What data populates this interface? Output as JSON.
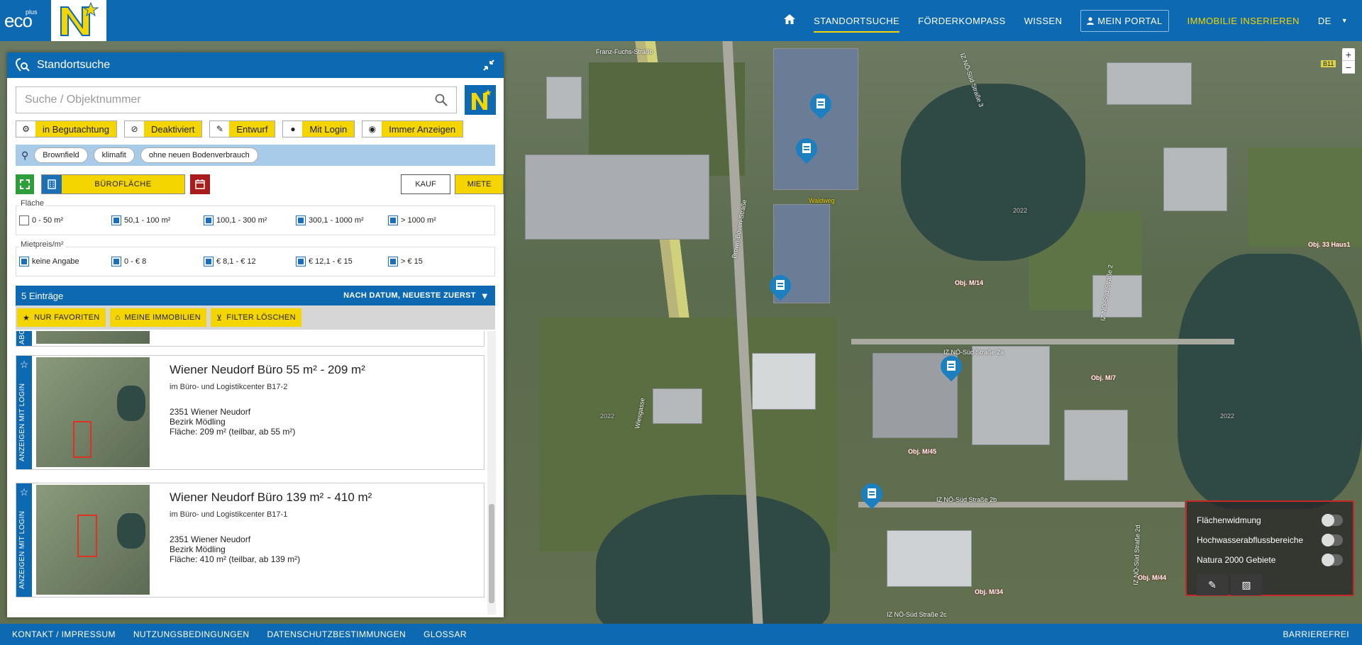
{
  "header": {
    "logo_text": "eco",
    "logo_plus": "plus",
    "nav": [
      "STANDORTSUCHE",
      "FÖRDERKOMPASS",
      "WISSEN"
    ],
    "portal": "MEIN PORTAL",
    "insert": "IMMOBILIE INSERIEREN",
    "lang": "DE",
    "accent": "#f5d500",
    "brand": "#0d69b1"
  },
  "panel": {
    "title": "Standortsuche",
    "search_placeholder": "Suche / Objektnummer",
    "status_buttons": [
      "in Begutachtung",
      "Deaktiviert",
      "Entwurf",
      "Mit Login",
      "Immer Anzeigen"
    ],
    "tags": [
      "Brownfield",
      "klimafit",
      "ohne neuen Bodenverbrauch"
    ],
    "type_label": "BÜROFLÄCHE",
    "kauf": "KAUF",
    "miete": "MIETE",
    "flaeche": {
      "caption": "Fläche",
      "options": [
        {
          "label": "0 - 50 m²",
          "checked": false
        },
        {
          "label": "50,1 - 100 m²",
          "checked": true
        },
        {
          "label": "100,1 - 300 m²",
          "checked": true
        },
        {
          "label": "300,1 - 1000 m²",
          "checked": true
        },
        {
          "label": "> 1000 m²",
          "checked": true
        }
      ]
    },
    "mietpreis": {
      "caption": "Mietpreis/m²",
      "options": [
        {
          "label": "keine Angabe",
          "checked": true
        },
        {
          "label": "0 - € 8",
          "checked": true
        },
        {
          "label": "€ 8,1 - € 12",
          "checked": true
        },
        {
          "label": "€ 12,1 - € 15",
          "checked": true
        },
        {
          "label": "> € 15",
          "checked": true
        }
      ]
    },
    "count": "5 Einträge",
    "sort": "NACH DATUM, NEUESTE ZUERST",
    "quick": [
      "NUR FAVORITEN",
      "MEINE IMMOBILIEN",
      "FILTER LÖSCHEN"
    ],
    "listings": [
      {
        "side": "ANZEIGEN MIT LOGIN",
        "title": "Wiener Neudorf Büro 55 m² - 209 m²",
        "subtitle": "im Büro- und Logistikcenter B17-2",
        "line1": "2351 Wiener Neudorf",
        "line2": "Bezirk Mödling",
        "line3": "Fläche: 209 m² (teilbar, ab 55 m²)"
      },
      {
        "side": "ANZEIGEN MIT LOGIN",
        "title": "Wiener Neudorf Büro 139 m² - 410 m²",
        "subtitle": "im Büro- und Logistikcenter B17-1",
        "line1": "2351 Wiener Neudorf",
        "line2": "Bezirk Mödling",
        "line3": "Fläche: 410 m² (teilbar, ab 139 m²)"
      }
    ],
    "partial_side": "ABG"
  },
  "map": {
    "streets": [
      "Franz-Fuchs-Straße",
      "Brown-Boveri-Straße",
      "Waldweg",
      "IZ NÖ-Süd Straße 3",
      "IZ NÖ-Süd Straße 2a",
      "IZ NÖ-Süd Straße 2b",
      "IZ NÖ-Süd Straße 2c",
      "IZ NÖ-Süd Straße 2d",
      "IZ NÖ-Süd Straße 2",
      "Wiesgasse",
      "B11"
    ],
    "objects": [
      "Obj. M/14",
      "Obj. M/7",
      "Obj. M/45",
      "Obj. M/34",
      "Obj. M/44",
      "Obj. 33 Haus1"
    ],
    "years": [
      "2022",
      "2022",
      "2022"
    ],
    "layers": [
      "Flächenwidmung",
      "Hochwasserabflussbereiche",
      "Natura 2000 Gebiete"
    ],
    "zoom_in": "+",
    "zoom_out": "−"
  },
  "footer": {
    "links": [
      "KONTAKT / IMPRESSUM",
      "NUTZUNGSBEDINGUNGEN",
      "DATENSCHUTZBESTIMMUNGEN",
      "GLOSSAR"
    ],
    "right": "BARRIEREFREI"
  }
}
